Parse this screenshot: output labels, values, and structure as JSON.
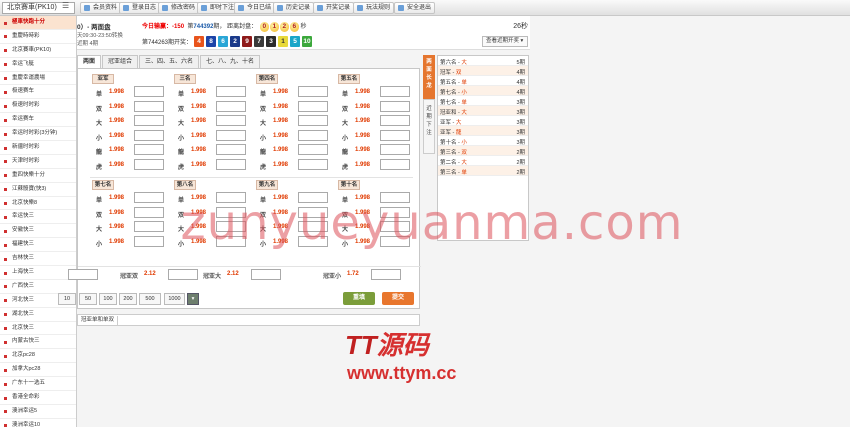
{
  "topbar": {
    "game_select": "北京賽車(PK10)",
    "buttons": [
      "会员资料",
      "登录日志",
      "修改密码",
      "即时下注",
      "今日已结",
      "历史记录",
      "开奖记录",
      "玩法规则",
      "安全退出"
    ]
  },
  "sidebar": {
    "items": [
      "極車快跑十分",
      "重慶時時彩",
      "北京賽車(PK10)",
      "幸运飞艇",
      "重慶幸運農場",
      "极速赛车",
      "极速时时彩",
      "幸运赛车",
      "幸运时时彩(3分钟)",
      "新疆时时彩",
      "天津时时彩",
      "重四快樂十分",
      "江蘇骰寶(快3)",
      "北京快樂8",
      "幸运快三",
      "安徽快三",
      "福建快三",
      "吉林快三",
      "上海快三",
      "广西快三",
      "河北快三",
      "湖北快三",
      "北京快三",
      "内蒙古快三",
      "北京pc28",
      "加拿大pc28",
      "广东十一选五",
      "香港全命彩",
      "澳洲幸运5",
      "澳洲幸运10"
    ]
  },
  "header": {
    "market": "0）- 两面盘",
    "close_time": "天09:30-23:50转换",
    "draw": "近期 4期",
    "today_label": "今日输赢：",
    "today_value": "-150",
    "issue_prefix": "第",
    "issue_no": "744392",
    "issue_suffix": "期，",
    "countdown_label": "距离封盘：",
    "countdown": [
      "0",
      "1",
      "2",
      "6"
    ],
    "countdown_unit": "秒",
    "timer": "26秒",
    "last_issue": "第744263期开奖：",
    "last_numbers": [
      {
        "n": "4",
        "color": "#e8541c"
      },
      {
        "n": "8",
        "color": "#1c44a8"
      },
      {
        "n": "6",
        "color": "#2aa6d6"
      },
      {
        "n": "2",
        "color": "#1b3a8a"
      },
      {
        "n": "9",
        "color": "#8e1a1a"
      },
      {
        "n": "7",
        "color": "#3a3a3a"
      },
      {
        "n": "3",
        "color": "#2b2b2b"
      },
      {
        "n": "1",
        "color": "#e8d93a"
      },
      {
        "n": "5",
        "color": "#1aa6c8"
      },
      {
        "n": "10",
        "color": "#3ca83c"
      }
    ],
    "recent_button": "查看近期开奖 ▾"
  },
  "tabs": [
    "两面",
    "冠亚组合",
    "三、四、五、六名",
    "七、八、九、十名"
  ],
  "groups_top": [
    {
      "name": "亚军",
      "rows": [
        [
          "单",
          "1.998"
        ],
        [
          "双",
          "1.998"
        ],
        [
          "大",
          "1.998"
        ],
        [
          "小",
          "1.998"
        ],
        [
          "龍",
          "1.998"
        ],
        [
          "虎",
          "1.998"
        ]
      ]
    },
    {
      "name": "三名",
      "rows": [
        [
          "单",
          "1.998"
        ],
        [
          "双",
          "1.998"
        ],
        [
          "大",
          "1.998"
        ],
        [
          "小",
          "1.998"
        ],
        [
          "龍",
          "1.998"
        ],
        [
          "虎",
          "1.998"
        ]
      ]
    },
    {
      "name": "第四名",
      "rows": [
        [
          "单",
          "1.998"
        ],
        [
          "双",
          "1.998"
        ],
        [
          "大",
          "1.998"
        ],
        [
          "小",
          "1.998"
        ],
        [
          "龍",
          "1.998"
        ],
        [
          "虎",
          "1.998"
        ]
      ]
    },
    {
      "name": "第五名",
      "rows": [
        [
          "单",
          "1.998"
        ],
        [
          "双",
          "1.998"
        ],
        [
          "大",
          "1.998"
        ],
        [
          "小",
          "1.998"
        ],
        [
          "龍",
          "1.998"
        ],
        [
          "虎",
          "1.998"
        ]
      ]
    }
  ],
  "groups_bottom": [
    {
      "name": "第七名",
      "rows": [
        [
          "单",
          "1.998"
        ],
        [
          "双",
          "1.998"
        ],
        [
          "大",
          "1.998"
        ],
        [
          "小",
          "1.998"
        ]
      ]
    },
    {
      "name": "第八名",
      "rows": [
        [
          "单",
          "1.998"
        ],
        [
          "双",
          "1.998"
        ],
        [
          "大",
          "1.998"
        ],
        [
          "小",
          "1.998"
        ]
      ]
    },
    {
      "name": "第九名",
      "rows": [
        [
          "单",
          "1.998"
        ],
        [
          "双",
          "1.998"
        ],
        [
          "大",
          "1.998"
        ],
        [
          "小",
          "1.998"
        ]
      ]
    },
    {
      "name": "第十名",
      "rows": [
        [
          "单",
          "1.998"
        ],
        [
          "双",
          "1.998"
        ],
        [
          "大",
          "1.998"
        ],
        [
          "小",
          "1.998"
        ]
      ]
    }
  ],
  "combo": [
    {
      "label": "冠亚双",
      "odds": "2.12"
    },
    {
      "label": "冠亚大",
      "odds": "2.12"
    },
    {
      "label": "冠亚小",
      "odds": "1.72"
    }
  ],
  "chips": [
    "10",
    "50",
    "100",
    "200",
    "500",
    "1000",
    "▾"
  ],
  "buttons": {
    "reset": "重填",
    "submit": "提交"
  },
  "subtab": "冠亚单和单双",
  "side_tabs": {
    "long": "两面长龙",
    "recent": "近期下注"
  },
  "streaks": [
    {
      "name": "第六名",
      "val": "大",
      "count": "5期"
    },
    {
      "name": "冠军",
      "val": "双",
      "count": "4期"
    },
    {
      "name": "第五名",
      "val": "单",
      "count": "4期"
    },
    {
      "name": "第七名",
      "val": "小",
      "count": "4期"
    },
    {
      "name": "第七名",
      "val": "单",
      "count": "3期"
    },
    {
      "name": "冠亚和",
      "val": "大",
      "count": "3期"
    },
    {
      "name": "亚军",
      "val": "大",
      "count": "3期"
    },
    {
      "name": "亚军",
      "val": "龍",
      "count": "3期"
    },
    {
      "name": "第十名",
      "val": "小",
      "count": "3期"
    },
    {
      "name": "第三名",
      "val": "双",
      "count": "2期"
    },
    {
      "name": "第二名",
      "val": "大",
      "count": "2期"
    },
    {
      "name": "第三名",
      "val": "单",
      "count": "2期"
    }
  ],
  "watermark": {
    "domain": "zunyueyuanma.com",
    "brand_tt": "TT",
    "brand_cn": "源码",
    "site": "www.ttym.cc"
  }
}
